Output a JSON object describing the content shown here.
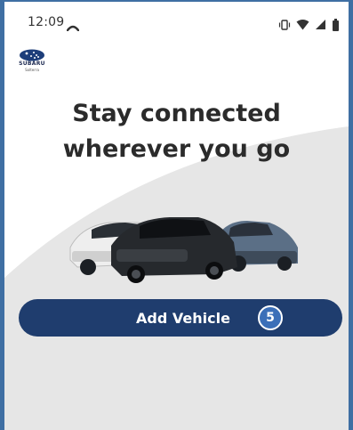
{
  "status_bar": {
    "time": "12:09",
    "icons": [
      "cast-icon",
      "vibrate-icon",
      "wifi-icon",
      "signal-icon",
      "battery-icon"
    ]
  },
  "brand": {
    "name": "SUBARU",
    "model": "Solterra"
  },
  "hero": {
    "line1": "Stay connected",
    "line2": "wherever you go"
  },
  "action": {
    "label": "Add Vehicle",
    "badge": "5"
  },
  "colors": {
    "frame_border": "#3f6fa3",
    "button_bg": "#1f3d6e",
    "badge_bg": "#3b6fb8",
    "curve_bg": "#e6e6e6",
    "headline": "#2b2b2b"
  }
}
